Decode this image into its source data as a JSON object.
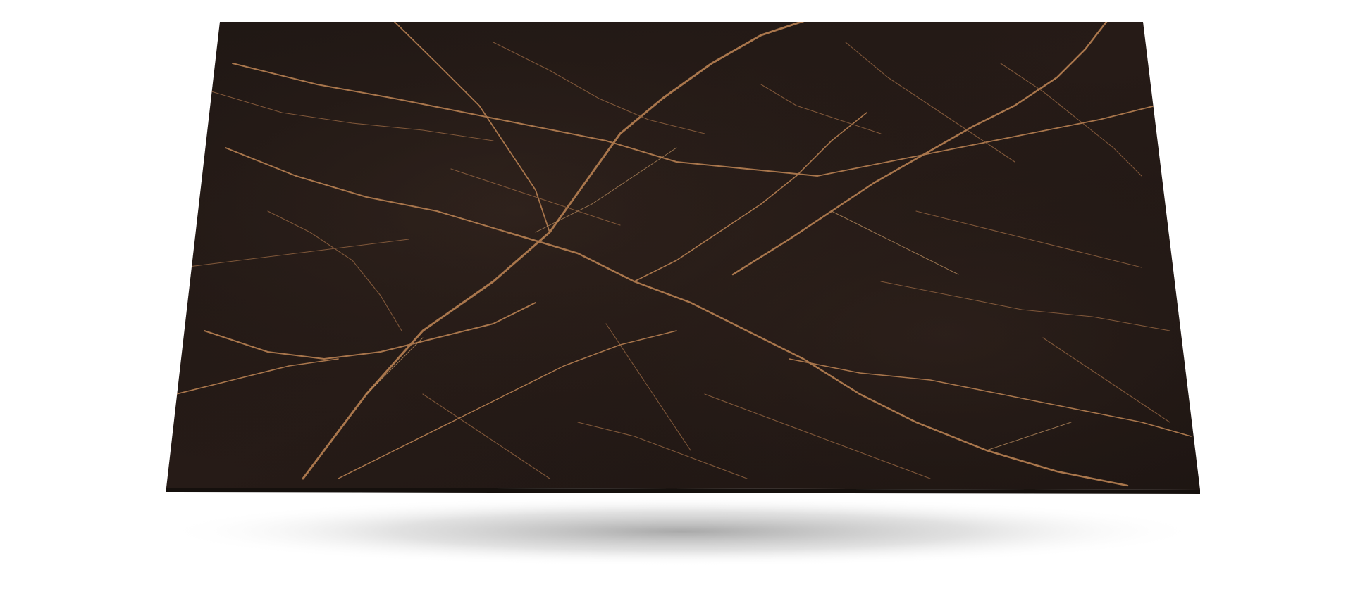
{
  "product": {
    "subject": "slab",
    "material": "marble",
    "colors": {
      "surface": "#241a16",
      "surface_light": "#2e221c",
      "vein": "#a9764c",
      "vein_light": "#c99866",
      "edge": "#15100d",
      "shadow": "#9a9a9a",
      "background": "#ffffff"
    }
  }
}
